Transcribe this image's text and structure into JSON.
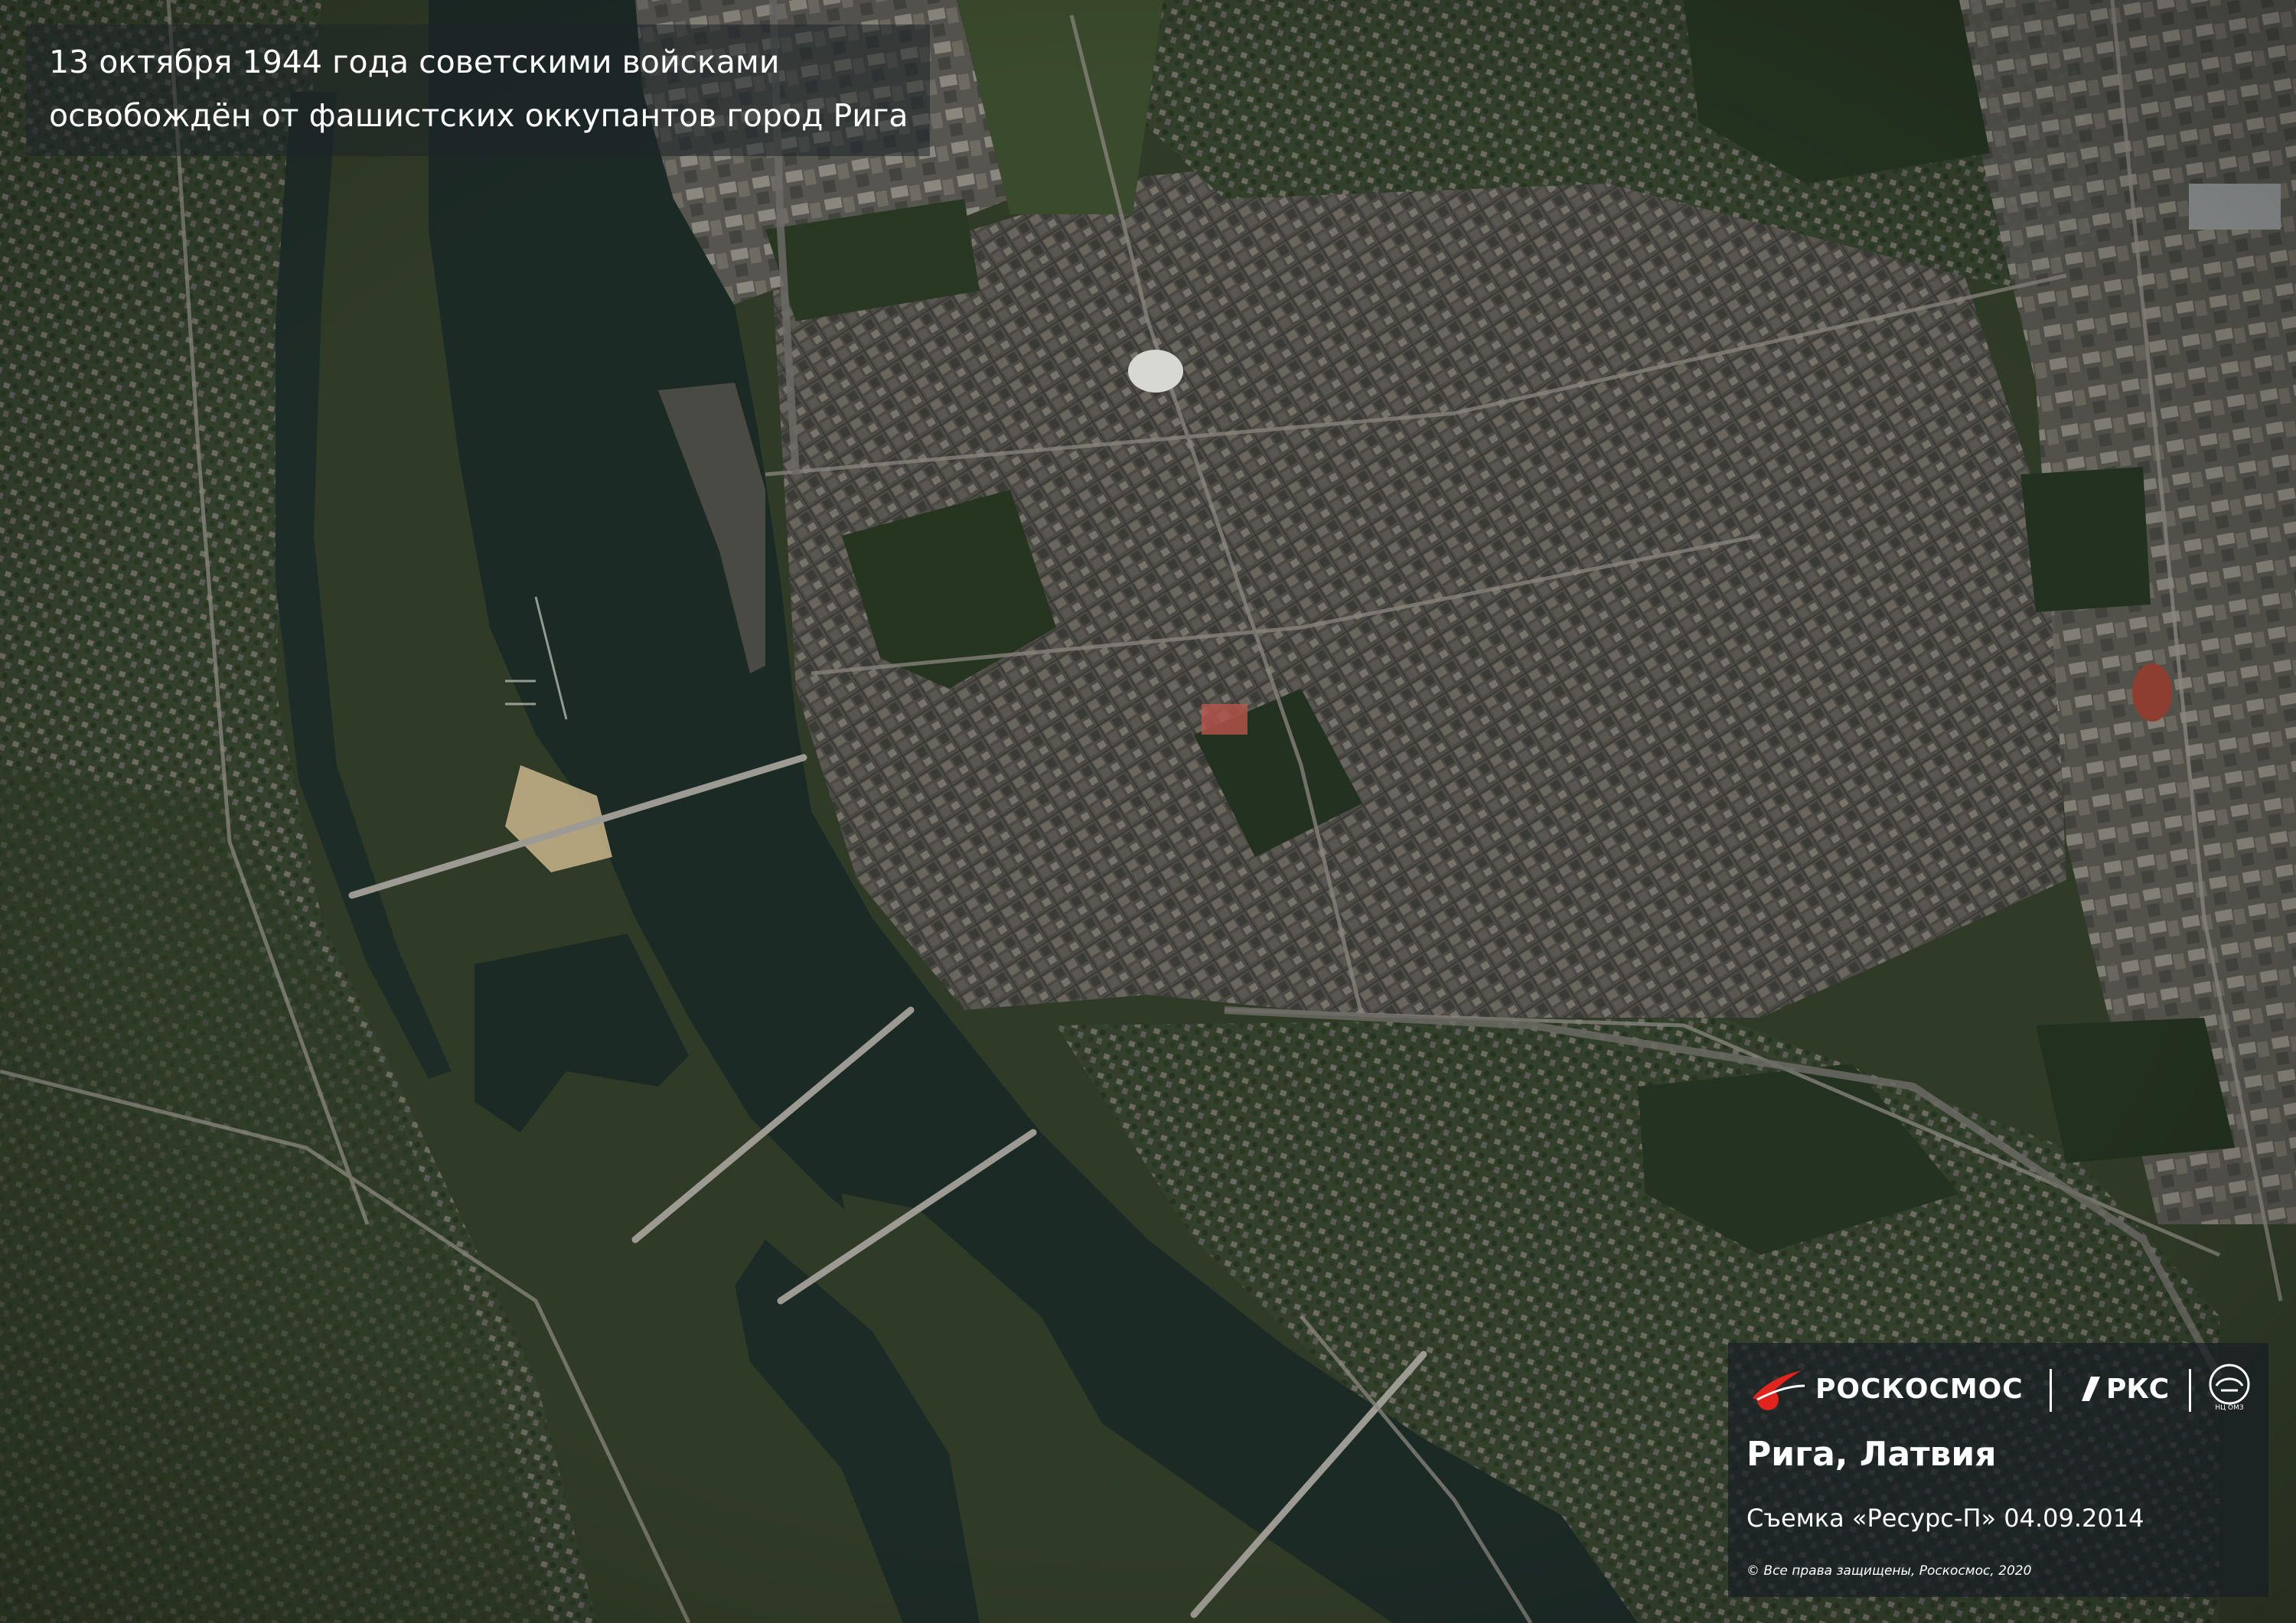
{
  "caption": {
    "line1": "13 октября 1944 года советскими войсками",
    "line2": "освобождён от фашистских оккупантов город Рига"
  },
  "info": {
    "logos": {
      "roscosmos": "РОСКОСМОС",
      "rks": "РКС",
      "nc_omz": "НЦ ОМЗ"
    },
    "place": "Рига, Латвия",
    "survey": "Съемка «Ресурс-П» 04.09.2014",
    "copyright": "© Все права защищены, Роскосмос, 2020"
  },
  "colors": {
    "river": "#1c2a26",
    "vegetation": "#2f3a26",
    "city": "#4a4944",
    "panel": "#181e24",
    "roscosmos_red": "#e3231d"
  }
}
